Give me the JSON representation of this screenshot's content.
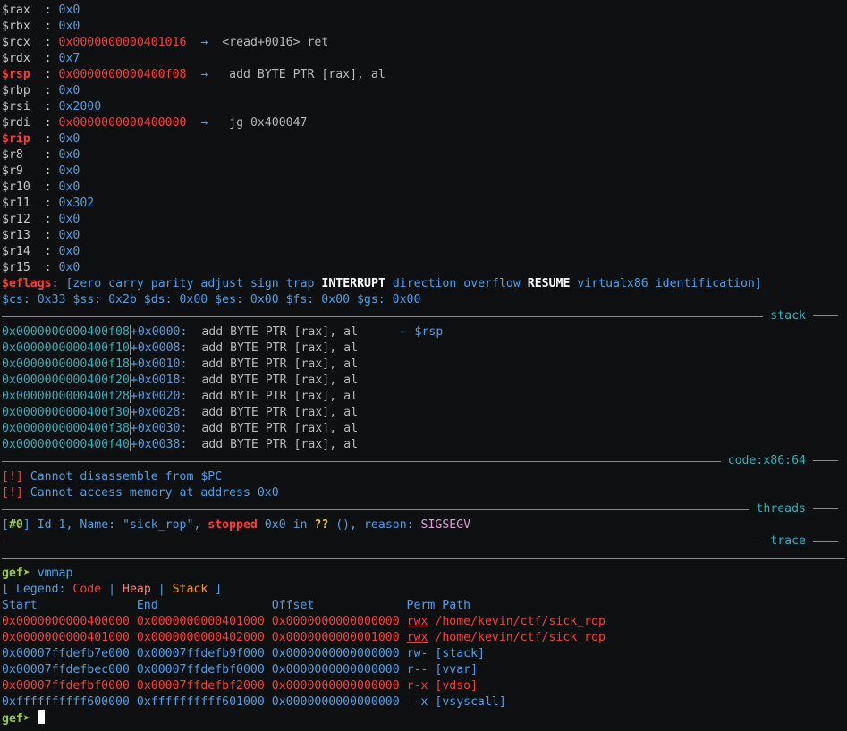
{
  "registers": [
    {
      "name": "$rax",
      "value": "0x0",
      "hot": false,
      "ptr": false
    },
    {
      "name": "$rbx",
      "value": "0x0",
      "hot": false,
      "ptr": false
    },
    {
      "name": "$rcx",
      "value": "0x0000000000401016",
      "hot": false,
      "ptr": true,
      "arrow": "→",
      "deref": "<read+0016> ret"
    },
    {
      "name": "$rdx",
      "value": "0x7",
      "hot": false,
      "ptr": false
    },
    {
      "name": "$rsp",
      "value": "0x0000000000400f08",
      "hot": true,
      "ptr": true,
      "arrow": "→",
      "deref": " add BYTE PTR [rax], al"
    },
    {
      "name": "$rbp",
      "value": "0x0",
      "hot": false,
      "ptr": false
    },
    {
      "name": "$rsi",
      "value": "0x2000",
      "hot": false,
      "ptr": false
    },
    {
      "name": "$rdi",
      "value": "0x0000000000400000",
      "hot": false,
      "ptr": true,
      "arrow": "→",
      "deref": " jg 0x400047"
    },
    {
      "name": "$rip",
      "value": "0x0",
      "hot": true,
      "ptr": false
    },
    {
      "name": "$r8",
      "value": "0x0",
      "hot": false,
      "ptr": false
    },
    {
      "name": "$r9",
      "value": "0x0",
      "hot": false,
      "ptr": false
    },
    {
      "name": "$r10",
      "value": "0x0",
      "hot": false,
      "ptr": false
    },
    {
      "name": "$r11",
      "value": "0x302",
      "hot": false,
      "ptr": false
    },
    {
      "name": "$r12",
      "value": "0x0",
      "hot": false,
      "ptr": false
    },
    {
      "name": "$r13",
      "value": "0x0",
      "hot": false,
      "ptr": false
    },
    {
      "name": "$r14",
      "value": "0x0",
      "hot": false,
      "ptr": false
    },
    {
      "name": "$r15",
      "value": "0x0",
      "hot": false,
      "ptr": false
    }
  ],
  "eflags": {
    "label": "$eflags",
    "open": "[",
    "flags": [
      {
        "text": "zero",
        "set": false
      },
      {
        "text": "carry",
        "set": false
      },
      {
        "text": "parity",
        "set": false
      },
      {
        "text": "adjust",
        "set": false
      },
      {
        "text": "sign",
        "set": false
      },
      {
        "text": "trap",
        "set": false
      },
      {
        "text": "INTERRUPT",
        "set": true
      },
      {
        "text": "direction",
        "set": false
      },
      {
        "text": "overflow",
        "set": false
      },
      {
        "text": "RESUME",
        "set": true
      },
      {
        "text": "virtualx86",
        "set": false
      },
      {
        "text": "identification",
        "set": false
      }
    ],
    "close": "]"
  },
  "segments": "$cs: 0x33 $ss: 0x2b $ds: 0x00 $es: 0x00 $fs: 0x00 $gs: 0x00",
  "sections": {
    "stack": "stack",
    "code": "code:x86:64",
    "threads": "threads",
    "trace": "trace"
  },
  "stack_rows": [
    {
      "addr": "0x0000000000400f08",
      "off": "+0x0000:",
      "insn": "  add BYTE PTR [rax], al",
      "note": "← $rsp"
    },
    {
      "addr": "0x0000000000400f10",
      "off": "+0x0008:",
      "insn": "  add BYTE PTR [rax], al",
      "note": ""
    },
    {
      "addr": "0x0000000000400f18",
      "off": "+0x0010:",
      "insn": "  add BYTE PTR [rax], al",
      "note": ""
    },
    {
      "addr": "0x0000000000400f20",
      "off": "+0x0018:",
      "insn": "  add BYTE PTR [rax], al",
      "note": ""
    },
    {
      "addr": "0x0000000000400f28",
      "off": "+0x0020:",
      "insn": "  add BYTE PTR [rax], al",
      "note": ""
    },
    {
      "addr": "0x0000000000400f30",
      "off": "+0x0028:",
      "insn": "  add BYTE PTR [rax], al",
      "note": ""
    },
    {
      "addr": "0x0000000000400f38",
      "off": "+0x0030:",
      "insn": "  add BYTE PTR [rax], al",
      "note": ""
    },
    {
      "addr": "0x0000000000400f40",
      "off": "+0x0038:",
      "insn": "  add BYTE PTR [rax], al",
      "note": ""
    }
  ],
  "code_msgs": [
    {
      "tag": "[!]",
      "text": " Cannot disassemble from $PC"
    },
    {
      "tag": "[!]",
      "text": " Cannot access memory at address 0x0"
    }
  ],
  "thread": {
    "open": "[",
    "id": "#0",
    "close": "]",
    "mid": " Id 1, Name: \"sick_rop\", ",
    "state": "stopped",
    "pos": " 0x0 in ",
    "func": "??",
    "after": " (), reason: ",
    "reason": "SIGSEGV"
  },
  "prompt": "gef➤",
  "command": "vmmap",
  "legend": {
    "open": "[ Legend: ",
    "code": "Code",
    "sep1": " | ",
    "heap": "Heap",
    "sep2": " | ",
    "stack": "Stack",
    "close": " ]"
  },
  "vmmap_header": "Start              End                Offset             Perm Path",
  "vmmap_rows": [
    {
      "start": "0x0000000000400000",
      "end": "0x0000000000401000",
      "offset": "0x0000000000000000",
      "perm": "rwx",
      "path": "/home/kevin/ctf/sick_rop",
      "kind": "code"
    },
    {
      "start": "0x0000000000401000",
      "end": "0x0000000000402000",
      "offset": "0x0000000000001000",
      "perm": "rwx",
      "path": "/home/kevin/ctf/sick_rop",
      "kind": "code"
    },
    {
      "start": "0x00007ffdefb7e000",
      "end": "0x00007ffdefb9f000",
      "offset": "0x0000000000000000",
      "perm": "rw-",
      "path": "[stack]",
      "kind": "plain"
    },
    {
      "start": "0x00007ffdefbec000",
      "end": "0x00007ffdefbf0000",
      "offset": "0x0000000000000000",
      "perm": "r--",
      "path": "[vvar]",
      "kind": "plain"
    },
    {
      "start": "0x00007ffdefbf0000",
      "end": "0x00007ffdefbf2000",
      "offset": "0x0000000000000000",
      "perm": "r-x",
      "path": "[vdso]",
      "kind": "code"
    },
    {
      "start": "0xffffffffff600000",
      "end": "0xffffffffff601000",
      "offset": "0x0000000000000000",
      "perm": "--x",
      "path": "[vsyscall]",
      "kind": "plain"
    }
  ]
}
